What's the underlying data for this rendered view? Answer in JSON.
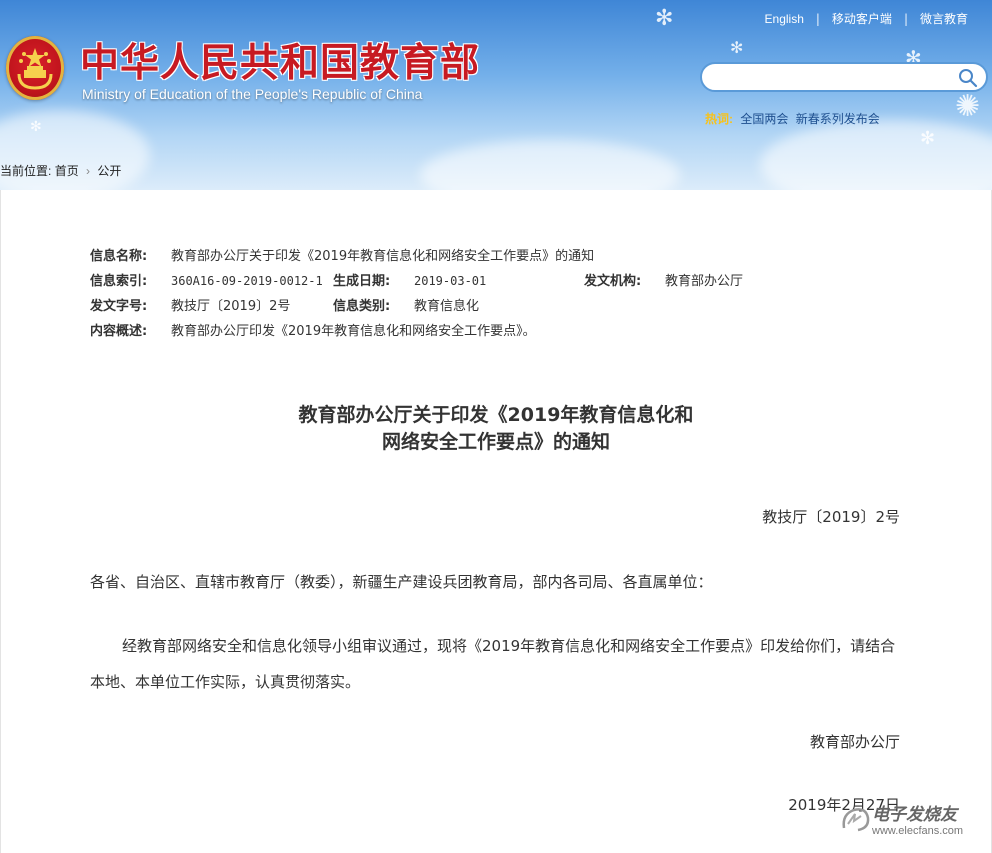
{
  "header": {
    "title": "中华人民共和国教育部",
    "subtitle": "Ministry of Education of the People's Republic of China",
    "top_links": [
      "English",
      "移动客户端",
      "微言教育"
    ],
    "search_placeholder": "",
    "hot_label": "热词:",
    "hot_links": [
      "全国两会",
      "新春系列发布会"
    ]
  },
  "breadcrumb": {
    "prefix": "当前位置:",
    "items": [
      "首页",
      "公开"
    ]
  },
  "meta": {
    "name_label": "信息名称:",
    "name_value": "教育部办公厅关于印发《2019年教育信息化和网络安全工作要点》的通知",
    "index_label": "信息索引:",
    "index_value": "360A16-09-2019-0012-1",
    "date_label": "生成日期:",
    "date_value": "2019-03-01",
    "org_label": "发文机构:",
    "org_value": "教育部办公厅",
    "docno_label": "发文字号:",
    "docno_value": "教技厅〔2019〕2号",
    "category_label": "信息类别:",
    "category_value": "教育信息化",
    "summary_label": "内容概述:",
    "summary_value": "教育部办公厅印发《2019年教育信息化和网络安全工作要点》。"
  },
  "document": {
    "title_line1": "教育部办公厅关于印发《2019年教育信息化和",
    "title_line2": "网络安全工作要点》的通知",
    "doc_number": "教技厅〔2019〕2号",
    "salutation": "各省、自治区、直辖市教育厅（教委），新疆生产建设兵团教育局，部内各司局、各直属单位：",
    "body": "经教育部网络安全和信息化领导小组审议通过，现将《2019年教育信息化和网络安全工作要点》印发给你们，请结合本地、本单位工作实际，认真贯彻落实。",
    "signature": "教育部办公厅",
    "date": "2019年2月27日"
  },
  "watermark": {
    "text": "电子发烧友",
    "url": "www.elecfans.com"
  },
  "colors": {
    "title_red": "#c71a22",
    "hot_yellow": "#f7c21b",
    "link_blue": "#1e4f8f",
    "header_top": "#3f86d6"
  },
  "icons": [
    "national-emblem-icon",
    "search-icon",
    "breadcrumb-arrow-icon",
    "watermark-logo-icon"
  ]
}
